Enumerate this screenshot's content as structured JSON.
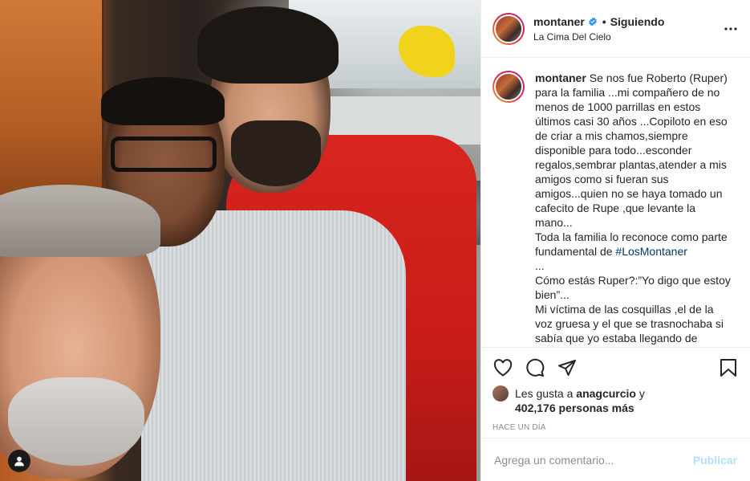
{
  "post": {
    "username": "montaner",
    "follow_status": "Siguiendo",
    "separator": "•",
    "location": "La Cima Del Cielo",
    "caption_before_tag": "Se nos fue Roberto (Ruper) para la familia ...mi compañero de no menos de 1000 parrillas en estos últimos casi 30 años ...Copiloto en eso de criar a mis chamos,siempre disponible para todo...esconder regalos,sembrar plantas,atender a mis amigos como si fueran sus amigos...quien no se haya tomado un cafecito de Rupe ,que levante la mano...\nToda la familia lo reconoce como parte fundamental de ",
    "hashtag": "#LosMontaner",
    "caption_after_tag": "\n...\nCómo estás Ruper?:”Yo digo que estoy bien”...\nMi víctima de las cosquillas ,el de la voz gruesa y el que se trasnochaba si sabía que yo estaba llegando de",
    "likes_prefix": "Les gusta a",
    "liker": "anagcurcio",
    "likes_conj": "y",
    "likes_count": "402,176 personas más",
    "time_ago": "HACE UN DÍA",
    "comment_placeholder": "Agrega un comentario...",
    "publish_label": "Publicar"
  },
  "icons": {
    "verified": "verified-badge-icon",
    "more": "more-options-icon",
    "like": "heart-icon",
    "comment": "comment-icon",
    "share": "share-icon",
    "save": "bookmark-icon",
    "tags": "user-tag-icon"
  },
  "colors": {
    "verified": "#3897f0",
    "hashtag": "#00376b",
    "publish_disabled": "#b2dffc",
    "muted": "#8e8e8e"
  }
}
